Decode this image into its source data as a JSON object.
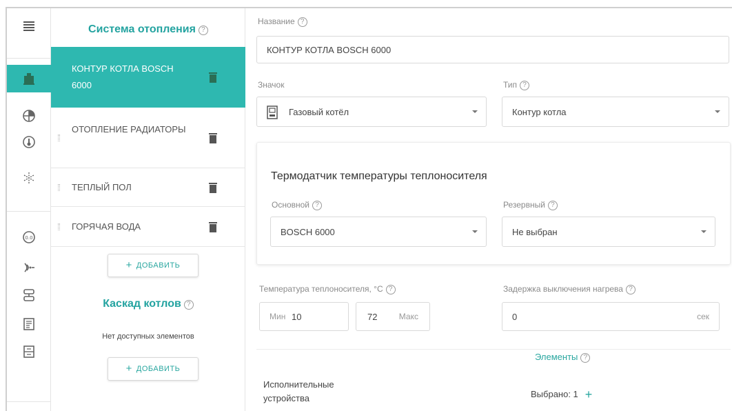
{
  "rail": {
    "icons": [
      {
        "name": "menu-icon"
      },
      {
        "name": "boiler-icon"
      },
      {
        "name": "radiator-icon"
      },
      {
        "name": "thermometer-icon"
      },
      {
        "name": "snowflake-icon"
      },
      {
        "name": "sensor-icon"
      },
      {
        "name": "signal-icon"
      },
      {
        "name": "valve-icon"
      },
      {
        "name": "schedule-icon"
      },
      {
        "name": "switch-icon"
      }
    ],
    "accent": "#2eb8b0"
  },
  "heating": {
    "title": "Система отопления",
    "items": [
      {
        "label": "Контур котла BOSCH 6000"
      },
      {
        "label": "Отопление радиаторы"
      },
      {
        "label": "Теплый пол"
      },
      {
        "label": "Горячая вода"
      }
    ],
    "add_label": "Добавить"
  },
  "cascade": {
    "title": "Каскад котлов",
    "empty": "Нет доступных элементов",
    "add_label": "Добавить"
  },
  "form": {
    "name_label": "Название",
    "name_value": "КОНТУР КОТЛА BOSCH 6000",
    "icon_label": "Значок",
    "icon_value": "Газовый котёл",
    "type_label": "Тип",
    "type_value": "Контур котла",
    "sensor_title": "Термодатчик температуры теплоносителя",
    "main_label": "Основной",
    "main_value": "BOSCH 6000",
    "reserve_label": "Резервный",
    "reserve_value": "Не выбран",
    "temp_label": "Температура теплоносителя, °С",
    "min_prefix": "Мин",
    "min_value": "10",
    "max_value": "72",
    "max_suffix": "Макс",
    "delay_label": "Задержка выключения нагрева",
    "delay_value": "0",
    "delay_unit": "сек",
    "elements_label": "Элементы",
    "exec_label": "Исполнительные устройства",
    "selected_label": "Выбрано: 1"
  }
}
